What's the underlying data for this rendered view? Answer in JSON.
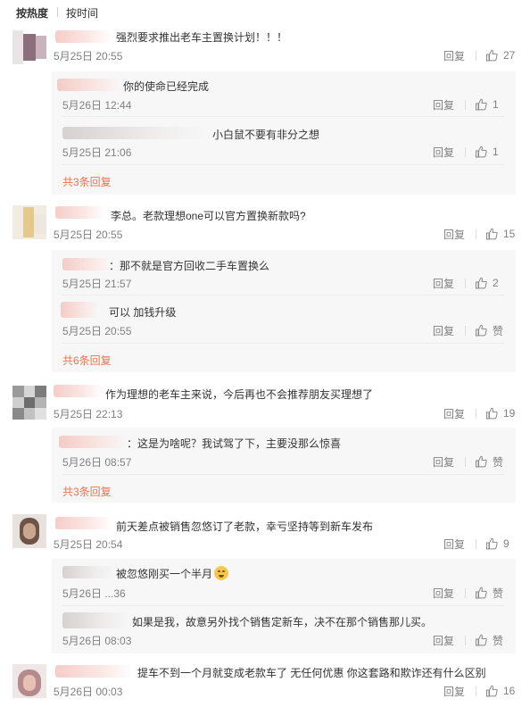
{
  "sort": {
    "hot": "按热度",
    "time": "按时间"
  },
  "labels": {
    "reply": "回复",
    "like": "赞"
  },
  "comments": [
    {
      "text": "强烈要求推出老车主置换计划！！！",
      "time": "5月25日 20:55",
      "likes": "27",
      "replies": [
        {
          "text": "你的使命已经完成",
          "time": "5月26日 12:44",
          "likes": "1"
        },
        {
          "text": "小白鼠不要有非分之想",
          "time": "5月25日 21:06",
          "likes": "1"
        }
      ],
      "more": "共3条回复"
    },
    {
      "text": "李总。老款理想one可以官方置换新款吗?",
      "time": "5月25日 20:55",
      "likes": "15",
      "replies": [
        {
          "text": "：那不就是官方回收二手车置换么",
          "time": "5月25日 21:57",
          "likes": "2"
        },
        {
          "text": "可以 加钱升级",
          "time": "5月25日 20:55",
          "likes": "赞"
        }
      ],
      "more": "共6条回复"
    },
    {
      "text": "作为理想的老车主来说，今后再也不会推荐朋友买理想了",
      "time": "5月25日 22:13",
      "time_visible": "5月25日 22:13",
      "likes": "19",
      "replies": [
        {
          "text": "：这是为啥呢？我试驾了下，主要没那么惊喜",
          "time": "5月26日 08:57",
          "likes": "赞"
        }
      ],
      "more": "共3条回复"
    },
    {
      "text": "前天差点被销售忽悠订了老款，幸亏坚持等到新车发布",
      "time": "5月25日 20:54",
      "likes": "9",
      "replies": [
        {
          "text": "被忽悠刚买一个半月",
          "time": "5月26日 ...36",
          "likes": "赞"
        },
        {
          "text": "如果是我，故意另外找个销售定新车，决不在那个销售那儿买。",
          "time": "5月26日 08:03",
          "likes": "赞"
        }
      ]
    },
    {
      "text": "提车不到一个月就变成老款车了  无任何优惠  你这套路和欺诈还有什么区别",
      "time": "5月26日 00:03",
      "likes": "16",
      "replies": []
    }
  ],
  "colors": {
    "accent": "#eb7350",
    "subbg": "#f7f7f7",
    "meta": "#808080"
  }
}
